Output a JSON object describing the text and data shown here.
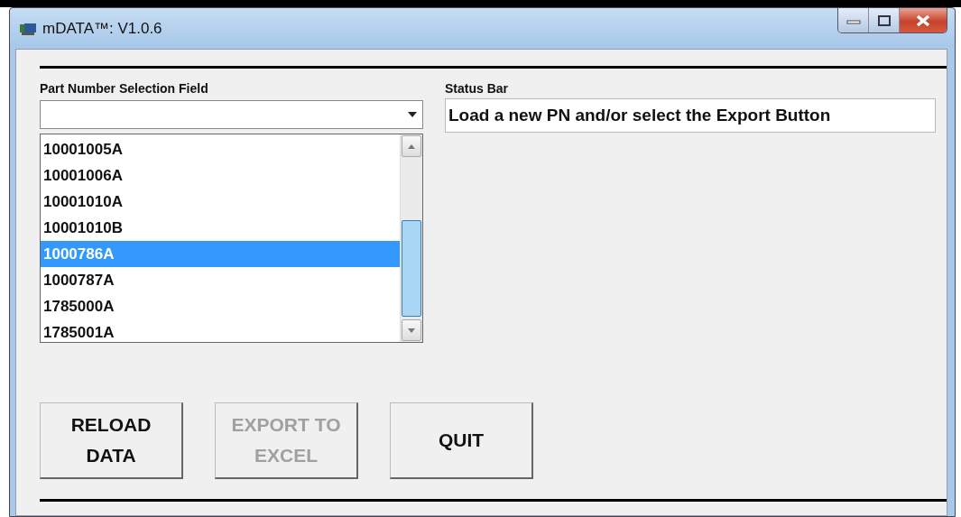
{
  "window": {
    "title": "mDATA™: V1.0.6"
  },
  "part_number_field": {
    "label": "Part Number Selection Field",
    "items": [
      {
        "label": "10001005A",
        "selected": false
      },
      {
        "label": "10001006A",
        "selected": false
      },
      {
        "label": "10001010A",
        "selected": false
      },
      {
        "label": "10001010B",
        "selected": false
      },
      {
        "label": "1000786A",
        "selected": true
      },
      {
        "label": "1000787A",
        "selected": false
      },
      {
        "label": "1785000A",
        "selected": false
      },
      {
        "label": "1785001A",
        "selected": false
      }
    ]
  },
  "status_bar": {
    "label": "Status Bar",
    "value": "Load a new PN and/or select the Export Button"
  },
  "buttons": [
    {
      "label": "RELOAD DATA",
      "disabled": false
    },
    {
      "label": "EXPORT TO EXCEL",
      "disabled": true
    },
    {
      "label": "QUIT",
      "disabled": false
    }
  ]
}
